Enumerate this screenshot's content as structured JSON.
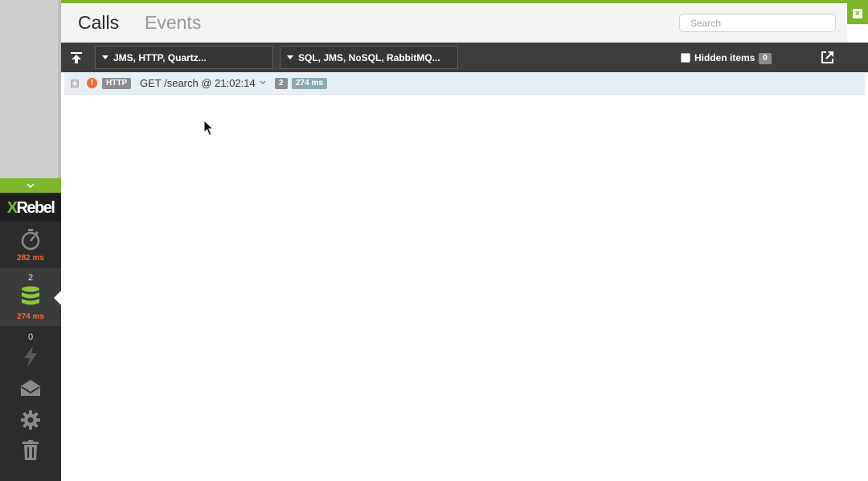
{
  "sidebar": {
    "logo_x": "X",
    "logo_rest": "Rebel",
    "timer": {
      "icon": "stopwatch-icon",
      "ms": "282 ms"
    },
    "database": {
      "icon": "database-icon",
      "count": "2",
      "ms": "274 ms"
    },
    "events": {
      "icon": "lightning-icon",
      "count": "0"
    },
    "mail": {
      "icon": "mail-icon"
    },
    "settings": {
      "icon": "gear-icon"
    },
    "trash": {
      "icon": "trash-icon"
    },
    "accent_color": "#7eb52b",
    "ms_color": "#f06a31"
  },
  "header": {
    "tabs": [
      {
        "label": "Calls",
        "active": true
      },
      {
        "label": "Events",
        "active": false
      }
    ],
    "search_placeholder": "Search"
  },
  "toolbar": {
    "filter_left": "JMS, HTTP, Quartz...",
    "filter_right": "SQL, JMS, NoSQL, RabbitMQ...",
    "hidden_items_label": "Hidden items",
    "hidden_items_count": "0"
  },
  "calls": [
    {
      "type": "HTTP",
      "label": "GET /search @ 21:02:14",
      "query_count": "2",
      "duration": "274 ms",
      "status": "error"
    }
  ]
}
